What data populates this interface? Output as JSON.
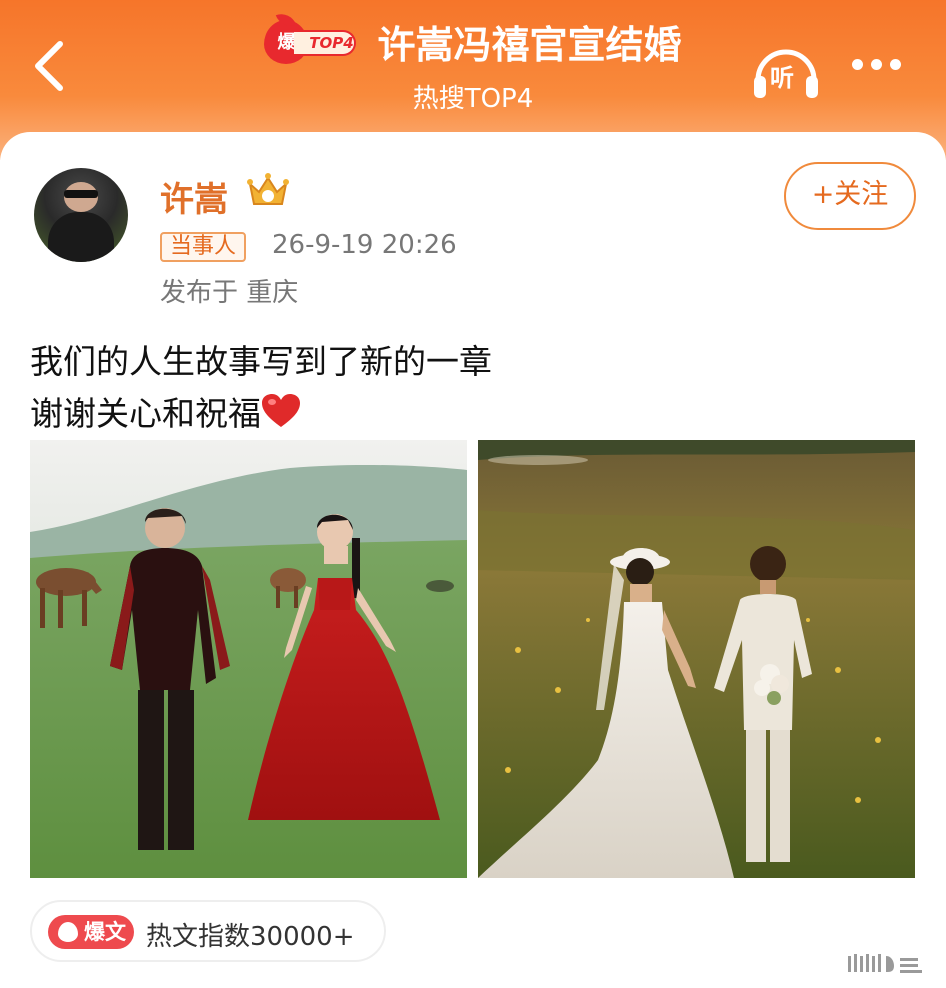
{
  "header": {
    "badge_char": "爆",
    "badge_top": "TOP4",
    "title": "许嵩冯禧官宣结婚",
    "subtitle": "热搜TOP4",
    "listen_label": "听"
  },
  "post": {
    "username": "许嵩",
    "tag": "当事人",
    "time": "26-9-19 20:26",
    "location": "发布于 重庆",
    "follow_label": "+关注",
    "text_line1": "我们的人生故事写到了新的一章",
    "text_line2": "谢谢关心和祝福",
    "hot_badge": "爆文",
    "hot_index": "热文指数30000+"
  },
  "colors": {
    "header_orange": "#f6752a",
    "accent_orange": "#e56a1f",
    "hot_red": "#ee4a4e"
  },
  "icons": [
    "back-arrow-icon",
    "hot-flame-icon",
    "headphone-icon",
    "more-dots-icon",
    "vip-crown-icon",
    "heart-icon"
  ]
}
